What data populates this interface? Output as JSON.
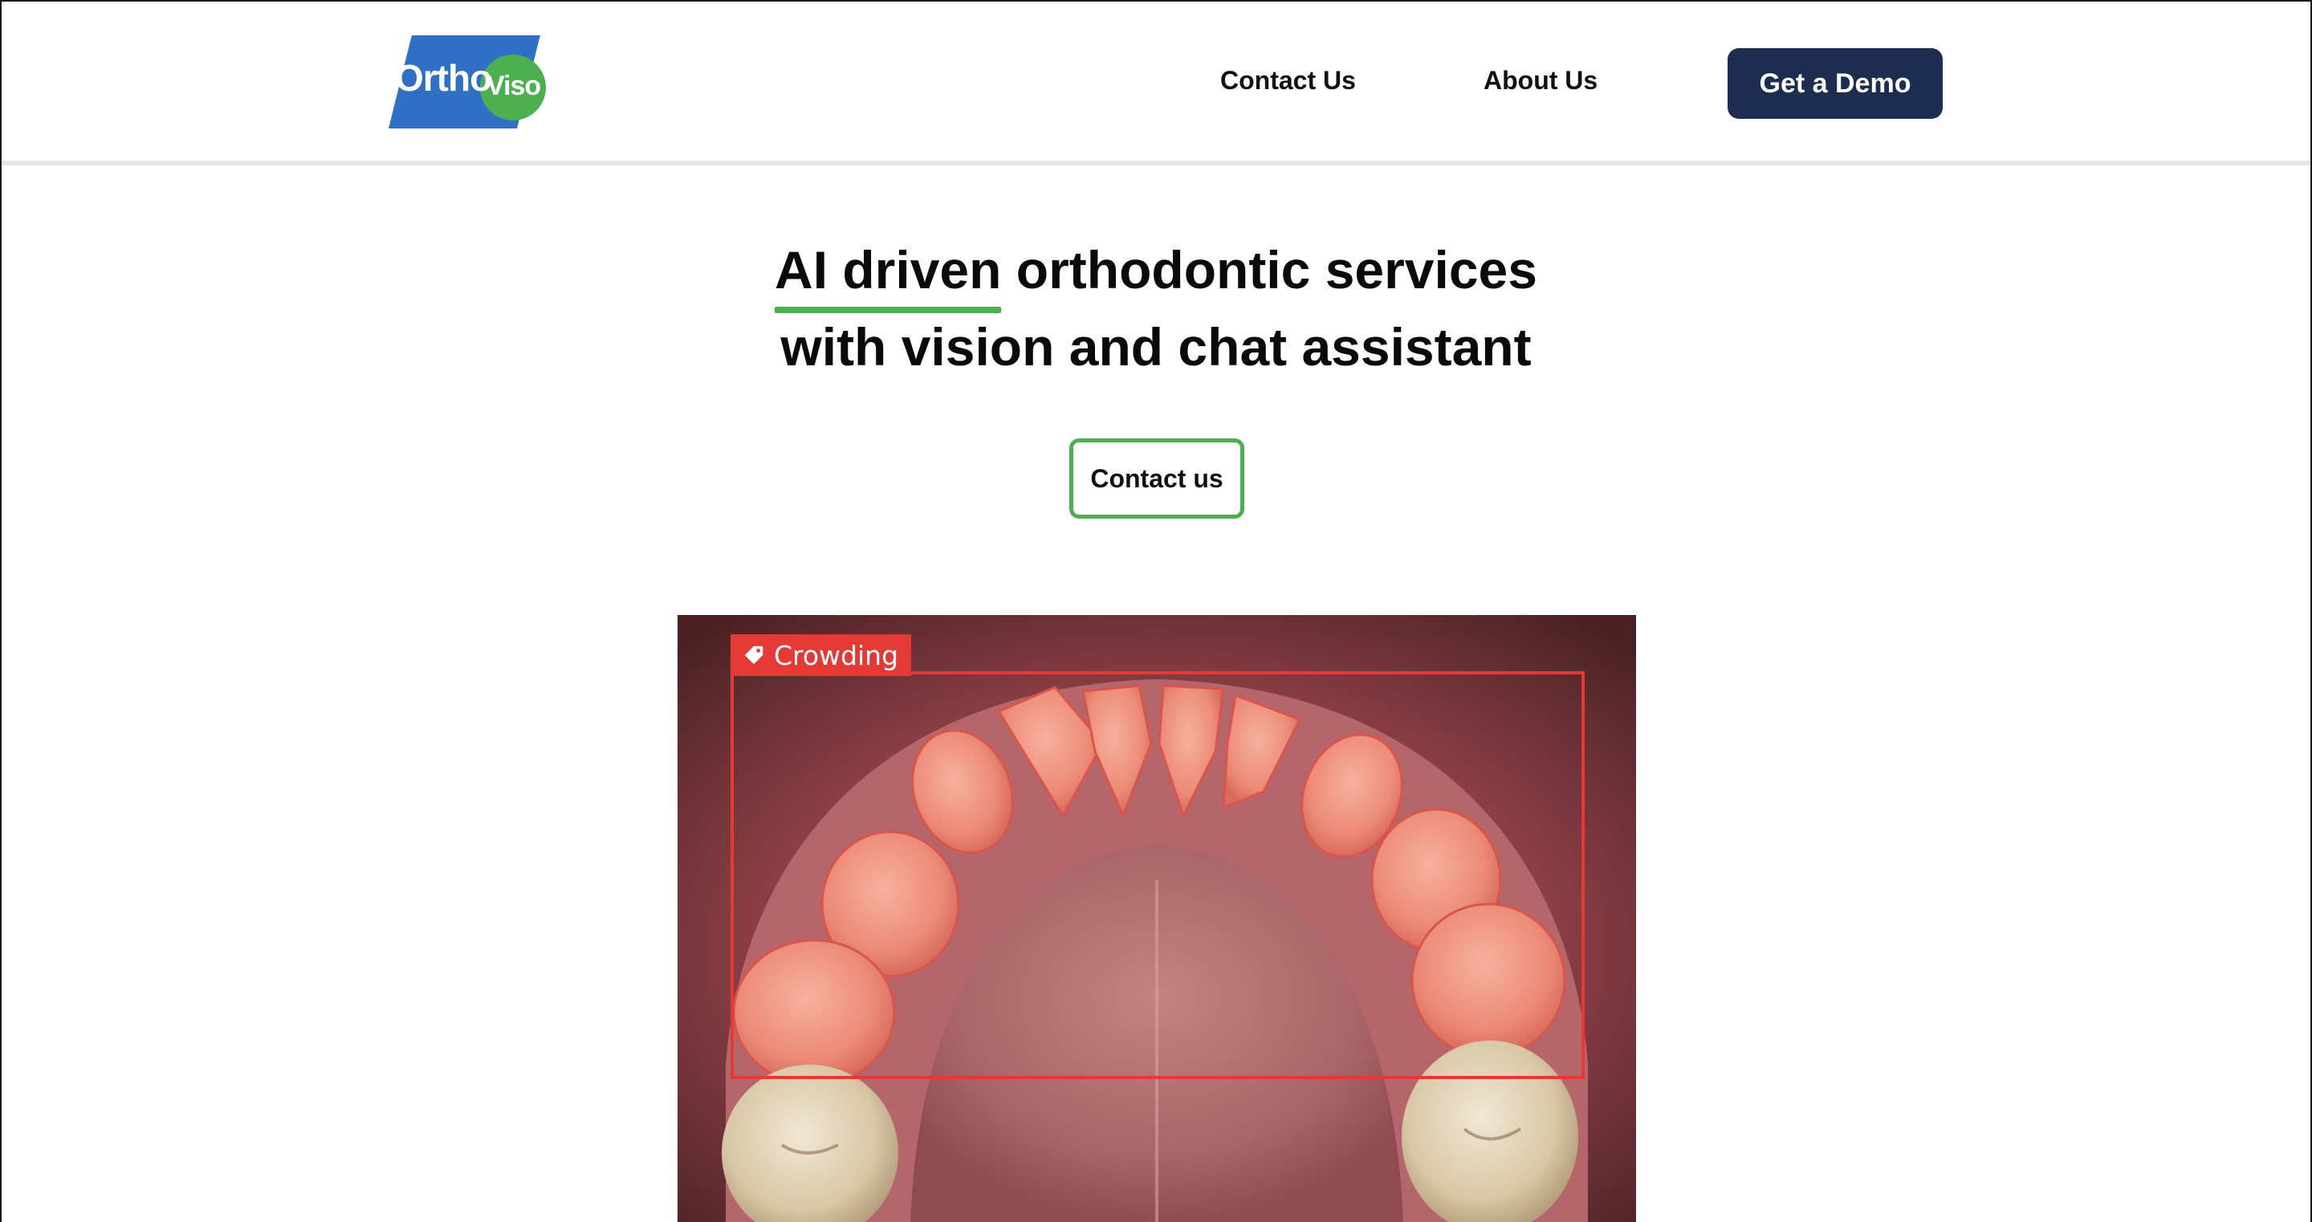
{
  "brand": {
    "name_part1": "Ortho",
    "name_part2": "Viso",
    "primary_color": "#2f6fc6",
    "secondary_color": "#4caf50"
  },
  "nav": {
    "contact_label": "Contact Us",
    "about_label": "About Us",
    "demo_label": "Get a Demo"
  },
  "hero": {
    "title_highlight": "AI driven",
    "title_rest_line1": " orthodontic services",
    "title_line2": "with vision and chat assistant",
    "cta_label": "Contact us",
    "accent_color": "#4caf50"
  },
  "detection": {
    "label": "Crowding",
    "icon": "tag-icon",
    "color": "#e53935"
  },
  "colors": {
    "demo_button_bg": "#1c2d4f",
    "detection_red": "#e53935"
  }
}
